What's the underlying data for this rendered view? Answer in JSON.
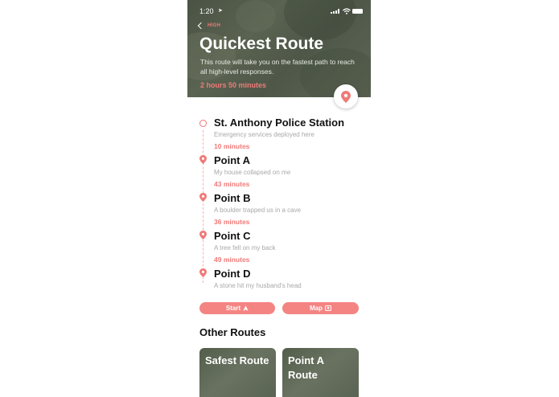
{
  "status_bar": {
    "time": "1:20"
  },
  "header": {
    "back_label": "HIGH",
    "title": "Quickest Route",
    "description": "This route will take you on the fastest path to reach all high-level responses.",
    "duration": "2 hours 50 minutes"
  },
  "stops": [
    {
      "name": "St. Anthony Police Station",
      "description": "Emergency services deployed here",
      "time": "10 minutes",
      "icon": "ring-icon"
    },
    {
      "name": "Point A",
      "description": "My house collapsed on me",
      "time": "43 minutes",
      "icon": "location-pin-icon"
    },
    {
      "name": "Point B",
      "description": "A boulder trapped us in a cave",
      "time": "36 minutes",
      "icon": "location-pin-icon"
    },
    {
      "name": "Point C",
      "description": "A tree fell on my back",
      "time": "49 minutes",
      "icon": "location-pin-icon"
    },
    {
      "name": "Point D",
      "description": "A stone hit my husband's head",
      "time": "",
      "icon": "location-pin-icon"
    }
  ],
  "actions": {
    "start_label": "Start",
    "map_label": "Map"
  },
  "other_routes": {
    "title": "Other Routes",
    "cards": [
      {
        "label": "Safest Route"
      },
      {
        "label": "Point A Route"
      }
    ]
  },
  "colors": {
    "accent": "#f07a78",
    "button": "#f48482",
    "text": "#111111",
    "muted": "#a8a8a8"
  }
}
